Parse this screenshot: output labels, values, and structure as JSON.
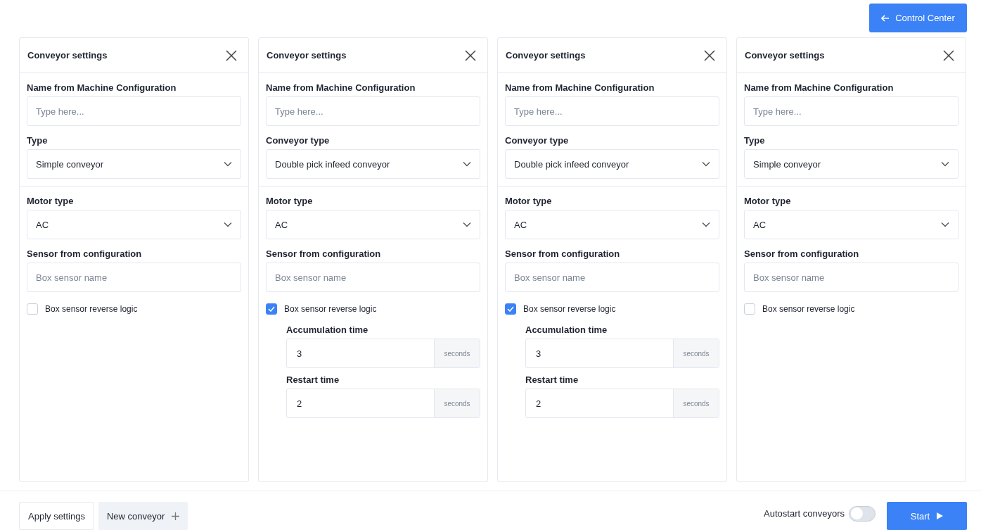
{
  "control_center_button": {
    "label": "Control Center"
  },
  "panels": [
    {
      "title": "Conveyor settings",
      "name": {
        "label": "Name from Machine Configuration",
        "placeholder": "Type here..."
      },
      "type": {
        "label": "Type",
        "value": "Simple conveyor"
      },
      "motor": {
        "label": "Motor type",
        "value": "AC"
      },
      "sensor": {
        "label": "Sensor from configuration",
        "placeholder": "Box sensor name"
      },
      "reverse_logic": {
        "label": "Box sensor reverse logic",
        "checked": false
      }
    },
    {
      "title": "Conveyor settings",
      "name": {
        "label": "Name from Machine Configuration",
        "placeholder": "Type here..."
      },
      "type": {
        "label": "Conveyor type",
        "value": "Double pick infeed conveyor"
      },
      "motor": {
        "label": "Motor type",
        "value": "AC"
      },
      "sensor": {
        "label": "Sensor from configuration",
        "placeholder": "Box sensor name"
      },
      "reverse_logic": {
        "label": "Box sensor reverse logic",
        "checked": true
      },
      "timings": [
        {
          "label": "Accumulation time",
          "value": "3",
          "unit": "seconds"
        },
        {
          "label": "Restart time",
          "value": "2",
          "unit": "seconds"
        }
      ]
    },
    {
      "title": "Conveyor settings",
      "name": {
        "label": "Name from Machine Configuration",
        "placeholder": "Type here..."
      },
      "type": {
        "label": "Conveyor type",
        "value": "Double pick infeed conveyor"
      },
      "motor": {
        "label": "Motor type",
        "value": "AC"
      },
      "sensor": {
        "label": "Sensor from configuration",
        "placeholder": "Box sensor name"
      },
      "reverse_logic": {
        "label": "Box sensor reverse logic",
        "checked": true
      },
      "timings": [
        {
          "label": "Accumulation time",
          "value": "3",
          "unit": "seconds"
        },
        {
          "label": "Restart time",
          "value": "2",
          "unit": "seconds"
        }
      ]
    },
    {
      "title": "Conveyor settings",
      "name": {
        "label": "Name from Machine Configuration",
        "placeholder": "Type here..."
      },
      "type": {
        "label": "Type",
        "value": "Simple conveyor"
      },
      "motor": {
        "label": "Motor type",
        "value": "AC"
      },
      "sensor": {
        "label": "Sensor from configuration",
        "placeholder": "Box sensor name"
      },
      "reverse_logic": {
        "label": "Box sensor reverse logic",
        "checked": false
      }
    }
  ],
  "footer": {
    "apply_button": "Apply settings",
    "new_conveyor_button": "New conveyor",
    "autostart": {
      "label": "Autostart conveyors",
      "on": false
    },
    "start_button": "Start"
  }
}
